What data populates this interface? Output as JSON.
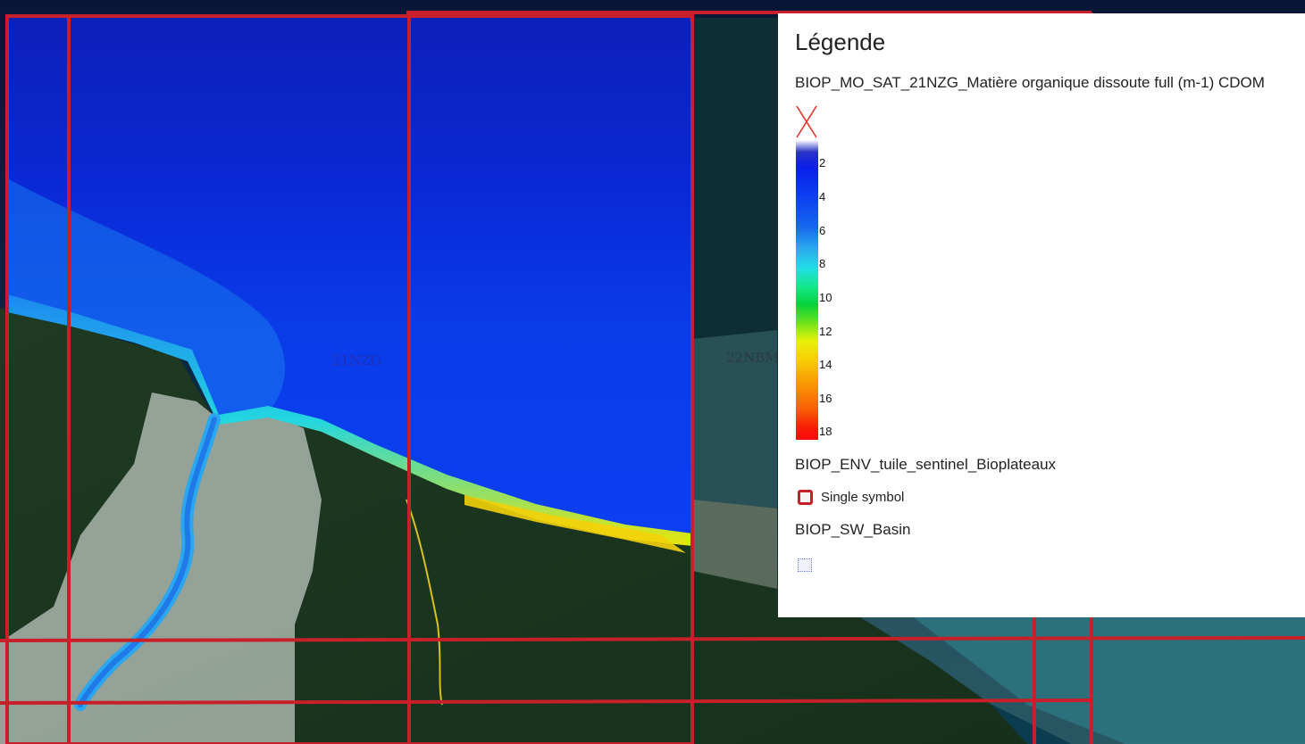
{
  "map": {
    "tile_labels": [
      "21NZG",
      "22NBM"
    ]
  },
  "legend": {
    "title": "Légende",
    "layers": [
      {
        "name": "BIOP_MO_SAT_21NZG_Matière organique dissoute full (m-1) CDOM",
        "nodata_icon": "red-x-icon",
        "ramp": {
          "ticks": [
            "2",
            "4",
            "6",
            "8",
            "10",
            "12",
            "14",
            "16",
            "18"
          ],
          "colors": [
            "#ffffff",
            "#0a1ee8",
            "#1667ee",
            "#2aa8ee",
            "#22dfe3",
            "#07d23a",
            "#e6f20a",
            "#f99a05",
            "#f95c05",
            "#f70808"
          ]
        }
      },
      {
        "name": "BIOP_ENV_tuile_sentinel_Bioplateaux",
        "symbol_label": "Single symbol",
        "symbol_color": "#c8202a"
      },
      {
        "name": "BIOP_SW_Basin",
        "symbol_color": "#6a7ee8"
      }
    ]
  }
}
